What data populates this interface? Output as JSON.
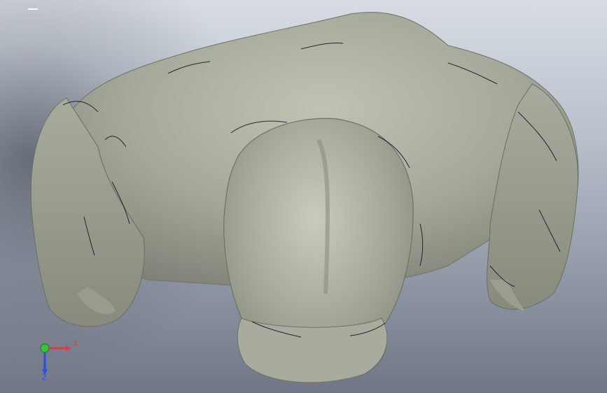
{
  "scene": {
    "background_top": "#d8dde4",
    "background_bottom": "#6f7786",
    "model_color": "#a7ab9d",
    "model_shadow": "#7c8075",
    "model_highlight": "#c5c8bc",
    "edge_color": "#111111"
  },
  "triad": {
    "x_label": "X",
    "z_label": "Z",
    "x_color": "#e23b3b",
    "y_color": "#38c23a",
    "z_color": "#2d4de2"
  }
}
